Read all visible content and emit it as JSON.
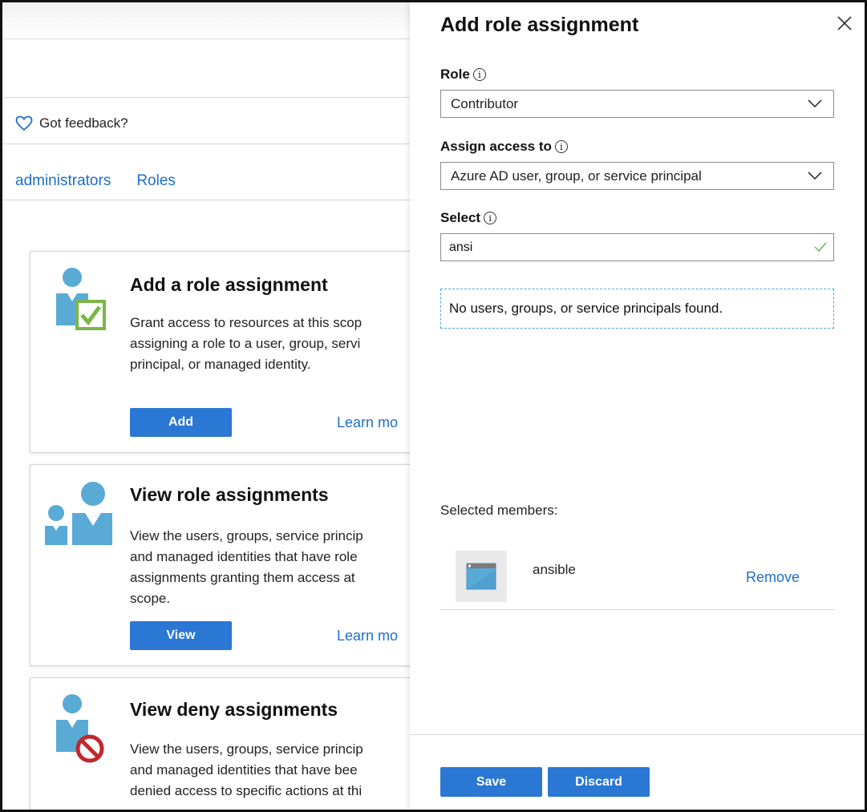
{
  "left_page": {
    "feedback_label": "Got feedback?",
    "tabs": [
      {
        "label": "administrators"
      },
      {
        "label": "Roles"
      }
    ],
    "cards": [
      {
        "icon": "user-check-icon",
        "title": "Add a role assignment",
        "desc_lines": [
          "Grant access to resources at this scop",
          "assigning a role to a user, group, servi",
          "principal, or managed identity."
        ],
        "button_label": "Add",
        "learn_label": "Learn mo"
      },
      {
        "icon": "users-icon",
        "title": "View role assignments",
        "desc_lines": [
          "View the users, groups, service princip",
          "and managed identities that have role",
          "assignments granting them access at",
          "scope."
        ],
        "button_label": "View",
        "learn_label": "Learn mo"
      },
      {
        "icon": "user-deny-icon",
        "title": "View deny assignments",
        "desc_lines": [
          "View the users, groups, service princip",
          "and managed identities that have bee",
          "denied access to specific actions at thi"
        ]
      }
    ]
  },
  "blade": {
    "title": "Add role assignment",
    "role": {
      "label": "Role",
      "value": "Contributor"
    },
    "assign_access": {
      "label": "Assign access to",
      "value": "Azure AD user, group, or service principal"
    },
    "select": {
      "label": "Select",
      "value": "ansi"
    },
    "no_results": "No users, groups, or service principals found.",
    "selected_members_label": "Selected members:",
    "members": [
      {
        "name": "ansible",
        "remove_label": "Remove"
      }
    ],
    "save_label": "Save",
    "discard_label": "Discard"
  },
  "colors": {
    "accent": "#2a77d4",
    "link": "#1f6fc5",
    "icon_blue": "#5aaad6",
    "check_green": "#7ab648",
    "deny_red": "#c0282d"
  }
}
